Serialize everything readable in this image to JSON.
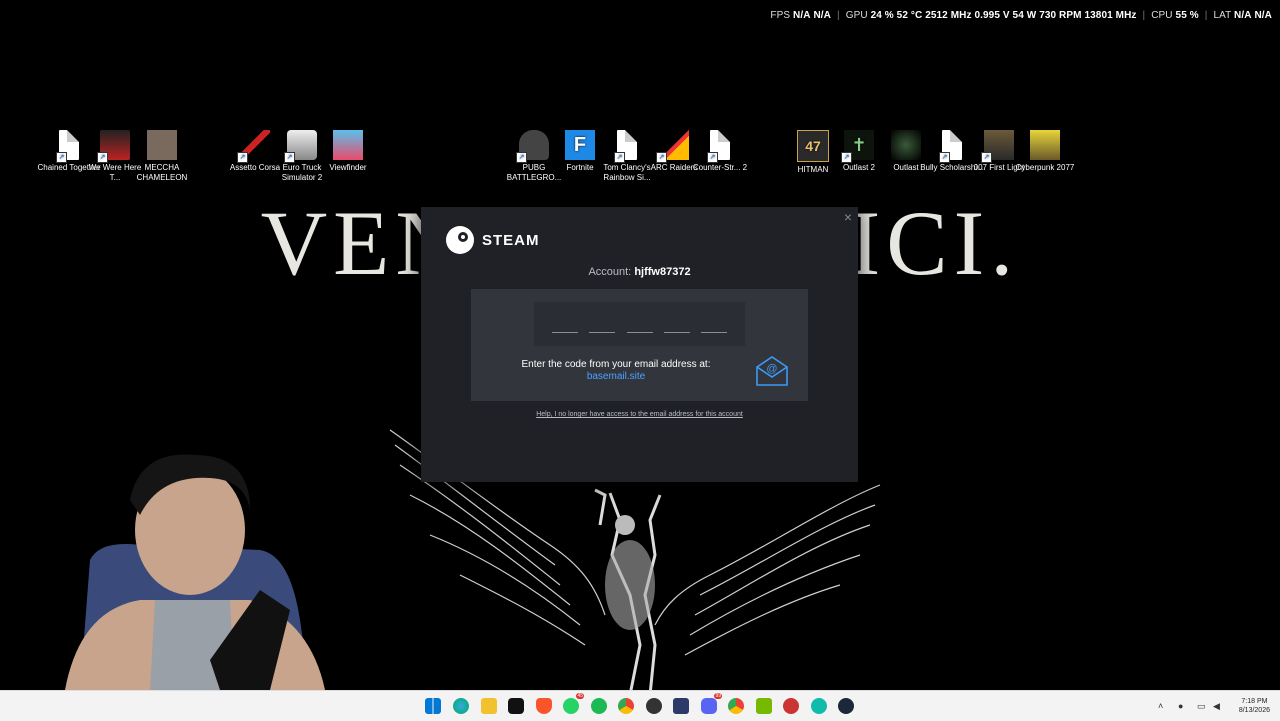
{
  "overlay": {
    "fps_label": "FPS",
    "fps1": "N/A",
    "fps2": "N/A",
    "gpu_label": "GPU",
    "gpu_util": "24 %",
    "gpu_temp": "52 °C",
    "gpu_clock": "2512 MHz",
    "gpu_volt": "0.995 V",
    "gpu_power": "54 W",
    "gpu_fan": "730 RPM",
    "gpu_mem": "13801 MHz",
    "cpu_label": "CPU",
    "cpu_util": "55 %",
    "lat_label": "LAT",
    "lat1": "N/A",
    "lat2": "N/A"
  },
  "wallpaper": {
    "text": "VENI VIDI VICI."
  },
  "desktop_icons": [
    {
      "label": "Chained Together",
      "icon": "file-icon"
    },
    {
      "label": "We Were Here T...",
      "icon": "game-icon"
    },
    {
      "label": "MECCHA CHAMELEON",
      "icon": "game-icon"
    },
    {
      "label": "Assetto Corsa",
      "icon": "game-icon"
    },
    {
      "label": "Euro Truck Simulator 2",
      "icon": "game-icon"
    },
    {
      "label": "Viewfinder",
      "icon": "game-icon"
    },
    {
      "label": "PUBG BATTLEGRO...",
      "icon": "game-icon"
    },
    {
      "label": "Fortnite",
      "icon": "game-icon"
    },
    {
      "label": "Tom Clancy's Rainbow Si...",
      "icon": "file-icon"
    },
    {
      "label": "ARC Raiders",
      "icon": "game-icon"
    },
    {
      "label": "Counter-Str... 2",
      "icon": "file-icon"
    },
    {
      "label": "HITMAN",
      "icon": "game-icon"
    },
    {
      "label": "Outlast 2",
      "icon": "game-icon"
    },
    {
      "label": "Outlast",
      "icon": "game-icon"
    },
    {
      "label": "Bully Scholarshi...",
      "icon": "file-icon"
    },
    {
      "label": "007 First Light",
      "icon": "game-icon"
    },
    {
      "label": "Cyberpunk 2077",
      "icon": "game-icon"
    }
  ],
  "dialog": {
    "logo_text": "STEAM",
    "account_label": "Account:",
    "account_name": "hjffw87372",
    "prompt": "Enter the code from your email address at:",
    "email_domain": "basemail.site",
    "help_link": "Help, I no longer have access to the email address for this account",
    "close": "×"
  },
  "taskbar": {
    "time": "7:18 PM",
    "date": "8/13/2026",
    "badges": {
      "whatsapp": "45",
      "discord": "99"
    }
  }
}
